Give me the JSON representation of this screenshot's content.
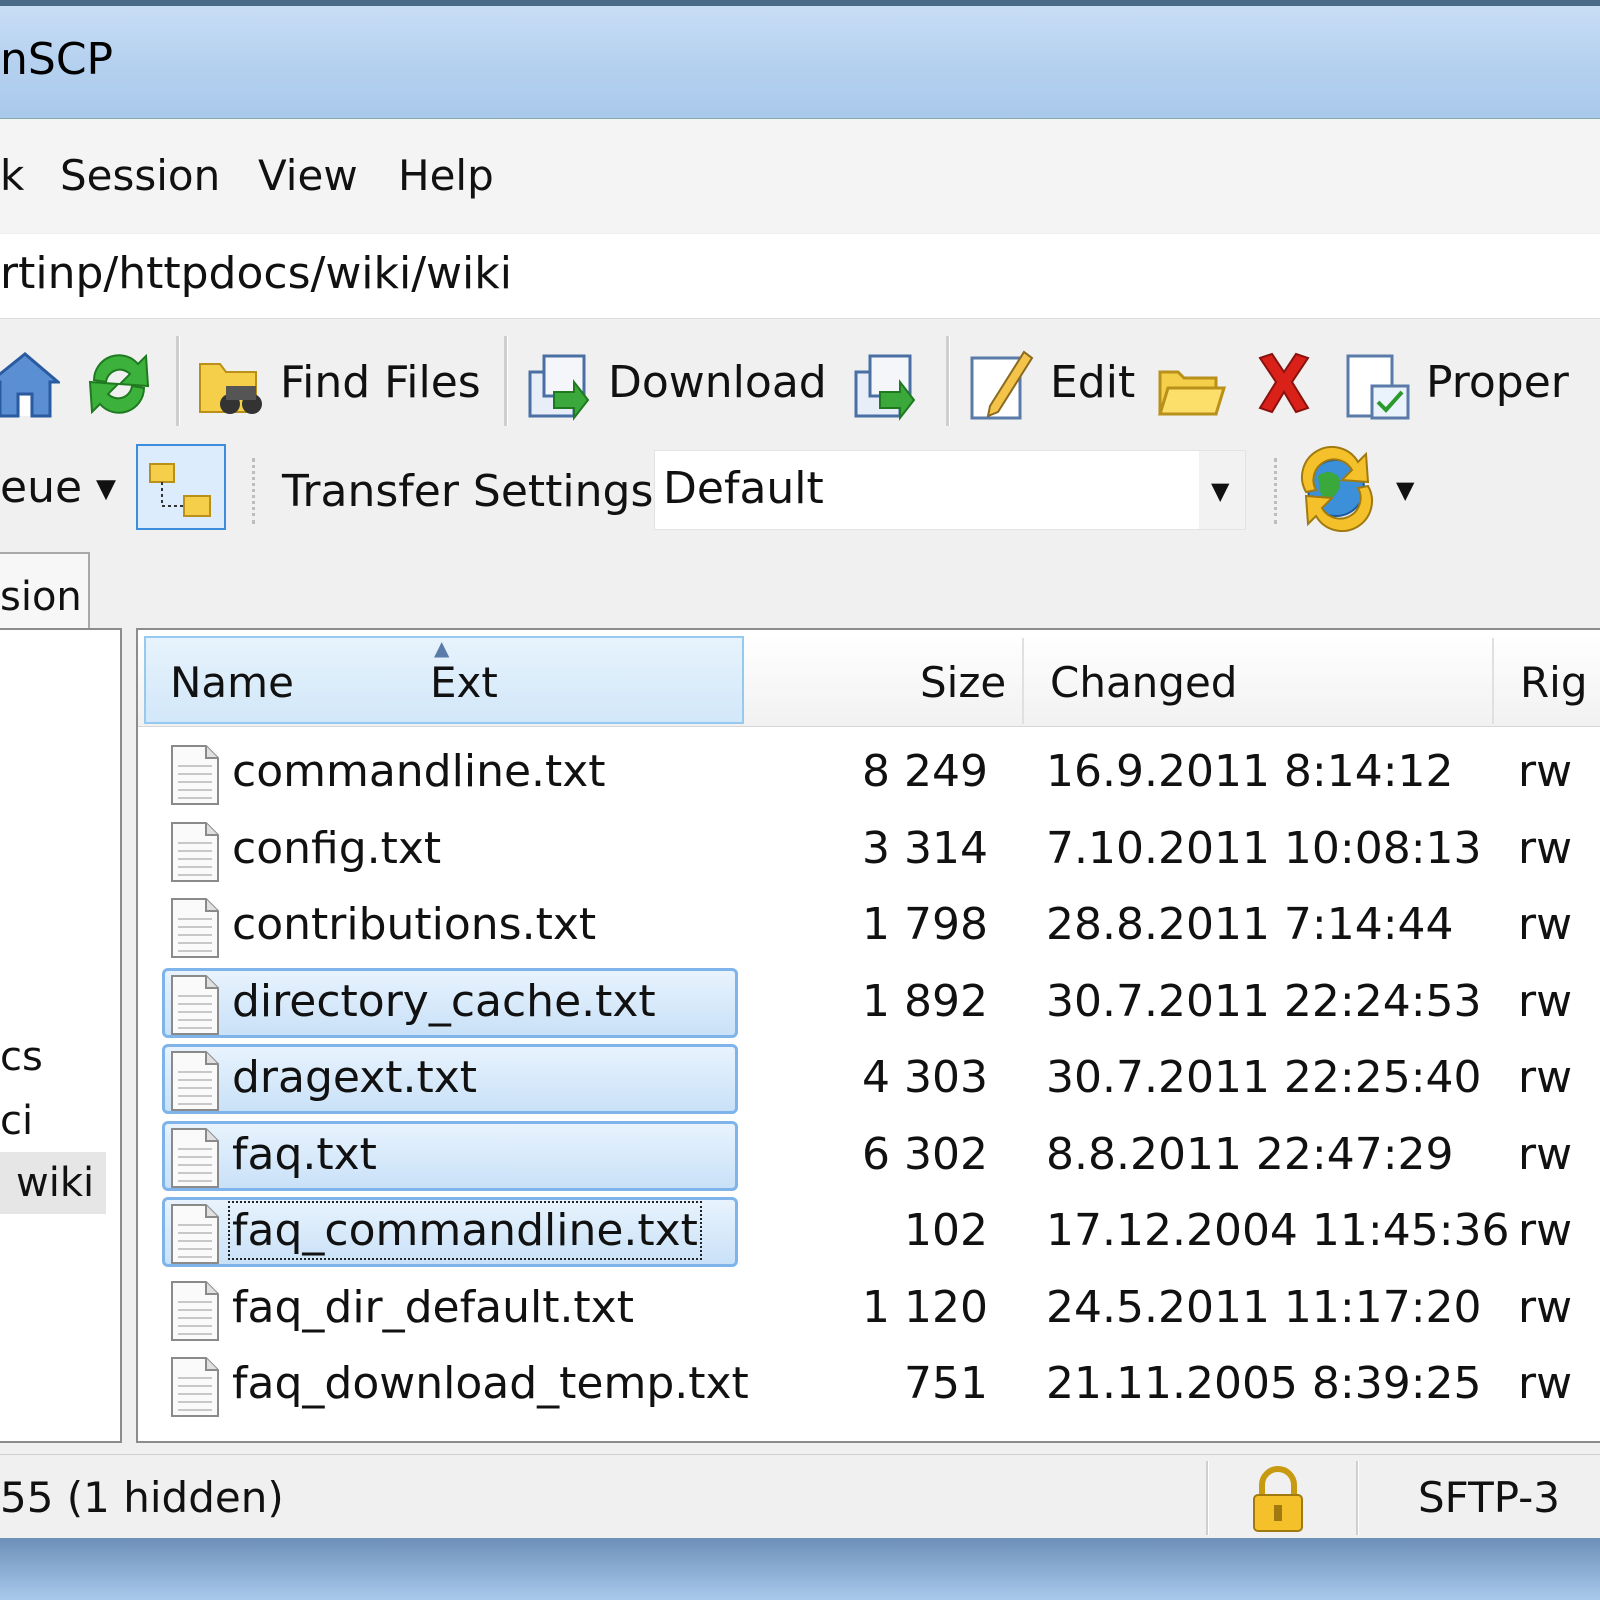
{
  "window": {
    "title": "nSCP"
  },
  "menu": {
    "items": [
      "k",
      "Session",
      "View",
      "Help"
    ]
  },
  "address": {
    "path": "rtinp/httpdocs/wiki/wiki"
  },
  "toolbar": {
    "find_files": "Find Files",
    "download": "Download",
    "edit": "Edit",
    "properties": "Proper"
  },
  "toolbar2": {
    "queue_label": "eue",
    "transfer_settings_label": "Transfer Settings",
    "transfer_settings_value": "Default"
  },
  "tabs": [
    {
      "label": "sion"
    }
  ],
  "tree": {
    "items": [
      "cs",
      "ci",
      "wiki"
    ]
  },
  "file_list": {
    "columns": {
      "name": "Name",
      "ext": "Ext",
      "size": "Size",
      "changed": "Changed",
      "rights": "Rig"
    },
    "rows": [
      {
        "name": "commandline.txt",
        "size": "8 249",
        "changed": "16.9.2011 8:14:12",
        "rights": "rw",
        "selected": false
      },
      {
        "name": "config.txt",
        "size": "3 314",
        "changed": "7.10.2011 10:08:13",
        "rights": "rw",
        "selected": false
      },
      {
        "name": "contributions.txt",
        "size": "1 798",
        "changed": "28.8.2011 7:14:44",
        "rights": "rw",
        "selected": false
      },
      {
        "name": "directory_cache.txt",
        "size": "1 892",
        "changed": "30.7.2011 22:24:53",
        "rights": "rw",
        "selected": true
      },
      {
        "name": "dragext.txt",
        "size": "4 303",
        "changed": "30.7.2011 22:25:40",
        "rights": "rw",
        "selected": true
      },
      {
        "name": "faq.txt",
        "size": "6 302",
        "changed": "8.8.2011 22:47:29",
        "rights": "rw",
        "selected": true
      },
      {
        "name": "faq_commandline.txt",
        "size": "102",
        "changed": "17.12.2004 11:45:36",
        "rights": "rw",
        "selected": true
      },
      {
        "name": "faq_dir_default.txt",
        "size": "1 120",
        "changed": "24.5.2011 11:17:20",
        "rights": "rw",
        "selected": false
      },
      {
        "name": "faq_download_temp.txt",
        "size": "751",
        "changed": "21.11.2005 8:39:25",
        "rights": "rw",
        "selected": false
      }
    ]
  },
  "status": {
    "text": "55 (1 hidden)",
    "protocol": "SFTP-3"
  },
  "colors": {
    "selection_border": "#7eb4ea",
    "title_bar": "#b7d2f0",
    "delete_red": "#d9211a"
  }
}
